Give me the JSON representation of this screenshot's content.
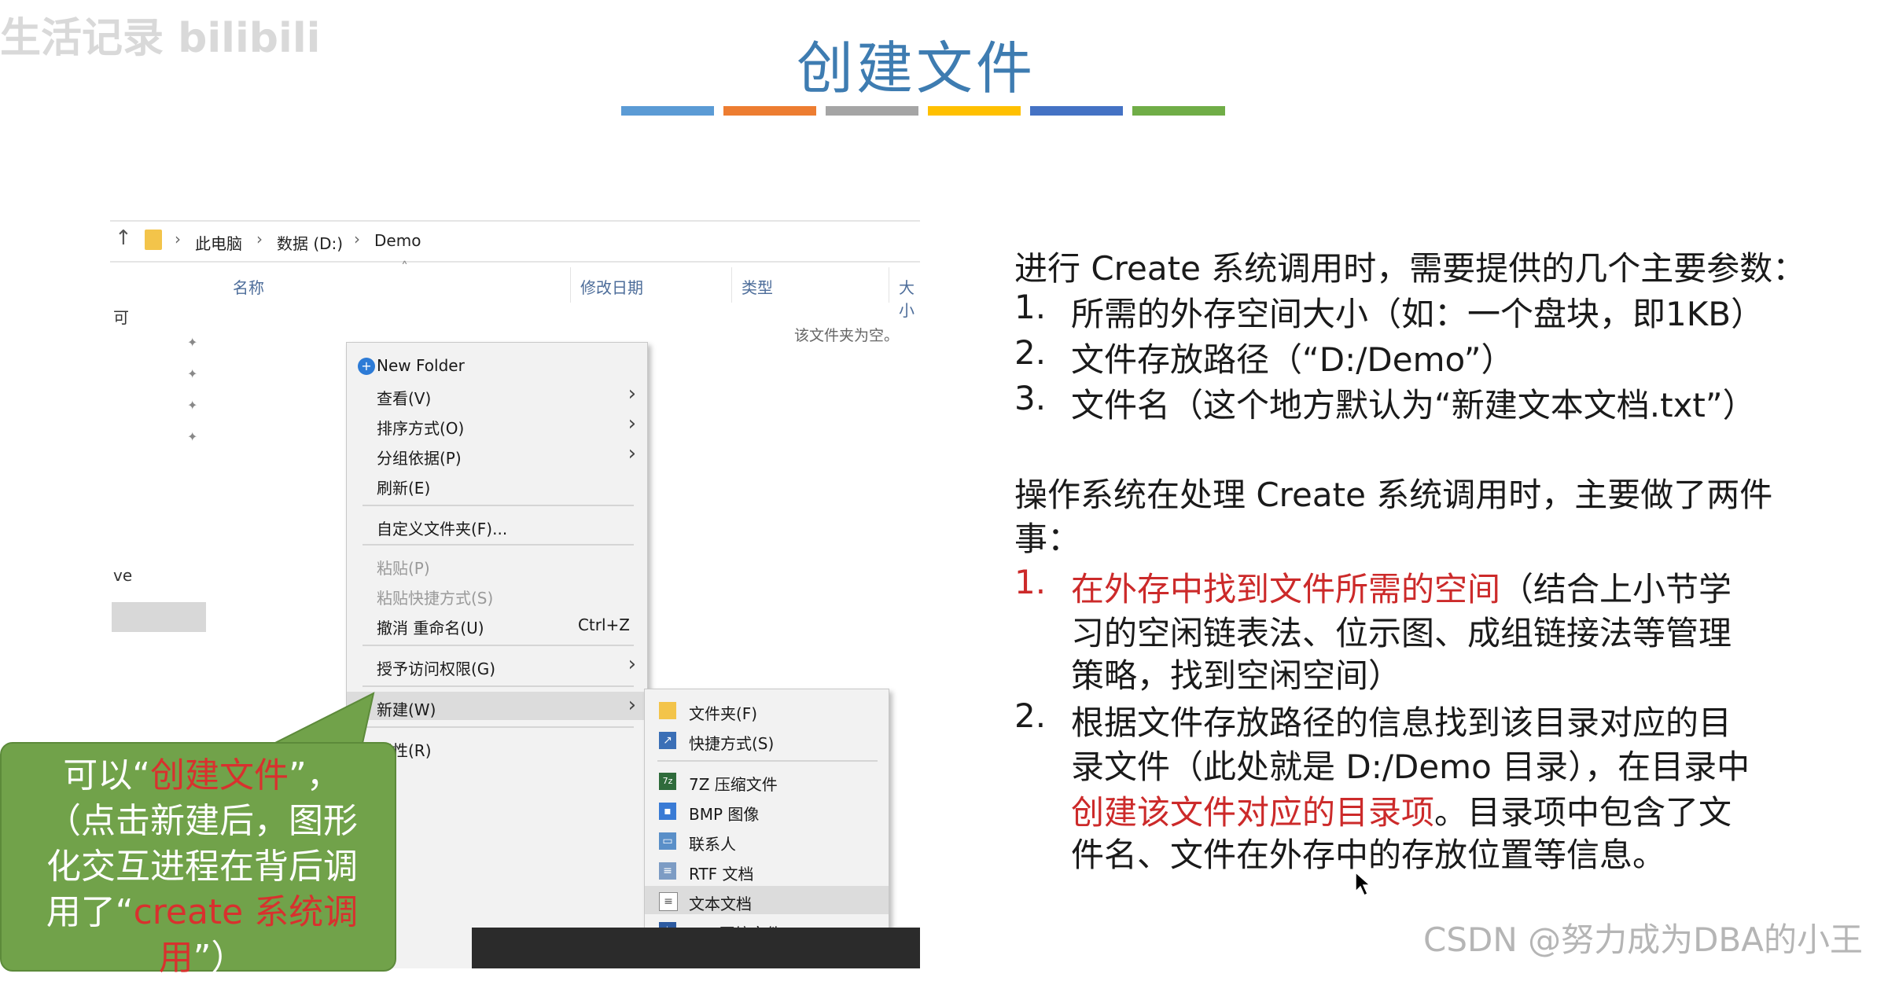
{
  "watermark_top_left": "生活记录 bilibili",
  "title": "创建文件",
  "title_bar_colors": [
    "#5b9bd5",
    "#ed7d31",
    "#a5a5a5",
    "#ffc000",
    "#4472c4",
    "#70ad47"
  ],
  "explorer": {
    "breadcrumb": [
      "此电脑",
      "数据 (D:)",
      "Demo"
    ],
    "left_pane_frag1": "可",
    "left_pane_frag2": "ve",
    "columns": [
      "名称",
      "修改日期",
      "类型",
      "大小"
    ],
    "empty_message": "该文件夹为空。"
  },
  "context_menu": {
    "items": [
      {
        "label": "New Folder"
      },
      {
        "label": "查看(V)"
      },
      {
        "label": "排序方式(O)"
      },
      {
        "label": "分组依据(P)"
      },
      {
        "label": "刷新(E)"
      },
      {
        "label": "自定义文件夹(F)..."
      },
      {
        "label": "粘贴(P)"
      },
      {
        "label": "粘贴快捷方式(S)"
      },
      {
        "label": "撤消 重命名(U)",
        "accel": "Ctrl+Z"
      },
      {
        "label": "授予访问权限(G)"
      },
      {
        "label": "新建(W)"
      },
      {
        "label": "属性(R)"
      }
    ]
  },
  "new_submenu": {
    "items": [
      {
        "label": "文件夹(F)"
      },
      {
        "label": "快捷方式(S)"
      },
      {
        "label": "7Z 压缩文件"
      },
      {
        "label": "BMP 图像"
      },
      {
        "label": "联系人"
      },
      {
        "label": "RTF 文档"
      },
      {
        "label": "文本文档"
      },
      {
        "label": "ZIP 压缩文件"
      }
    ]
  },
  "callout": {
    "line1a": "可以“",
    "line1b": "创建文件",
    "line1c": "”，",
    "line2": "（点击新建后，图形",
    "line3": "化交互进程在背后调",
    "line4a": "用了“",
    "line4b": "create 系统调",
    "line5a": "用",
    "line5b": "”）"
  },
  "right_text": {
    "intro": "进行 Create 系统调用时，需要提供的几个主要参数：",
    "params": [
      {
        "n": "1.",
        "text": "所需的外存空间大小（如：一个盘块，即1KB）"
      },
      {
        "n": "2.",
        "text": "文件存放路径（“D:/Demo”）"
      },
      {
        "n": "3.",
        "text": "文件名（这个地方默认为“新建文本文档.txt”）"
      }
    ],
    "os_line1": "操作系统在处理 Create 系统调用时，主要做了两件",
    "os_line2": "事：",
    "step1_n": "1.",
    "step1_red": "在外存中找到文件所需的空间",
    "step1_rest": "（结合上小节学",
    "step1_l2": "习的空闲链表法、位示图、成组链接法等管理",
    "step1_l3": "策略，找到空闲空间）",
    "step2_n": "2.",
    "step2_l1": "根据文件存放路径的信息找到该目录对应的目",
    "step2_l2": "录文件（此处就是 D:/Demo 目录），在目录中",
    "step2_l3_red": "创建该文件对应的目录项",
    "step2_l3_rest": "。目录项中包含了文",
    "step2_l4": "件名、文件在外存中的存放位置等信息。"
  },
  "csdn_watermark": "CSDN @努力成为DBA的小王"
}
